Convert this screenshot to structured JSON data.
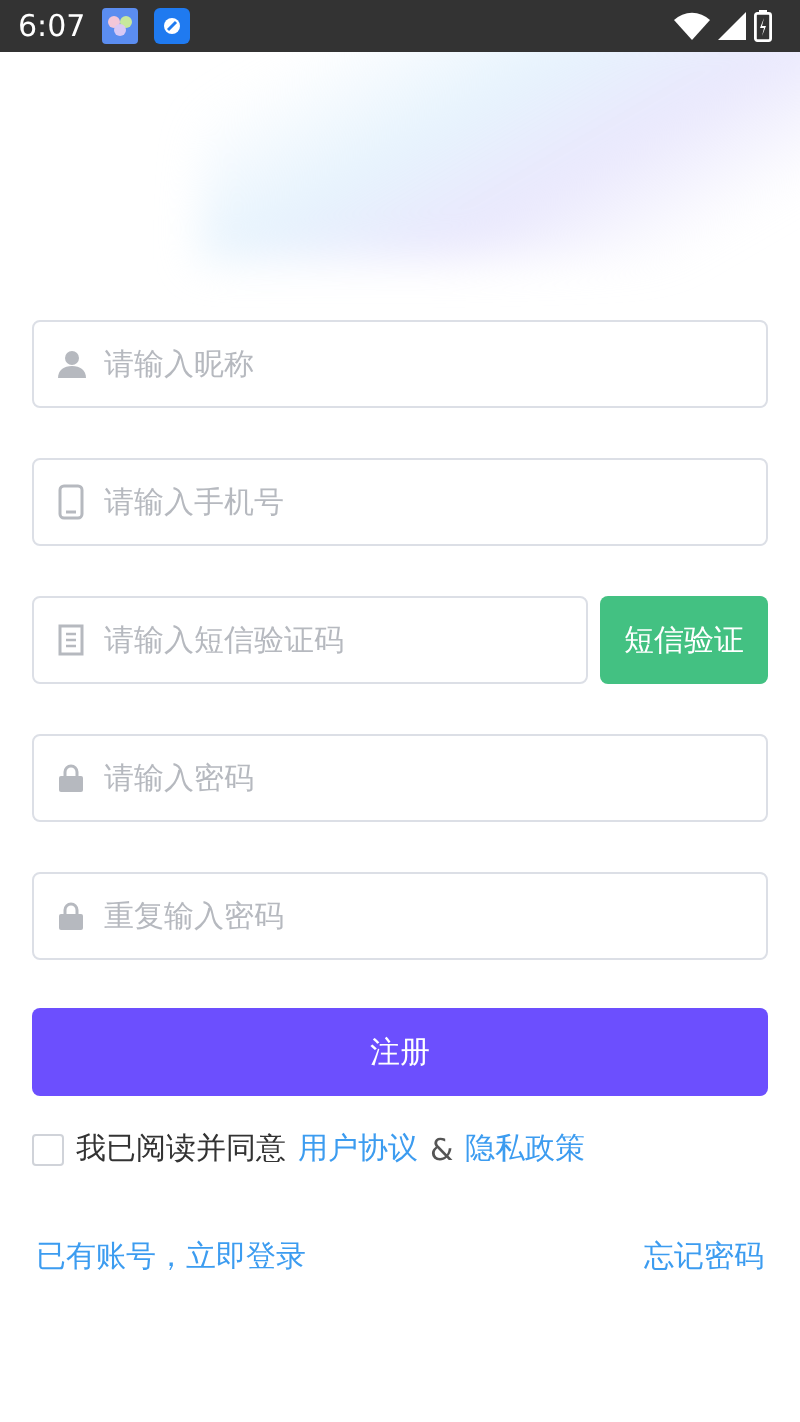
{
  "status_bar": {
    "time": "6:07"
  },
  "fields": [
    {
      "kind": "user",
      "placeholder": "请输入昵称"
    },
    {
      "kind": "phone",
      "placeholder": "请输入手机号"
    },
    {
      "kind": "code",
      "placeholder": "请输入短信验证码",
      "button": "短信验证"
    },
    {
      "kind": "lock",
      "placeholder": "请输入密码"
    },
    {
      "kind": "lock",
      "placeholder": "重复输入密码"
    }
  ],
  "submit_button": "注册",
  "agreement": {
    "checked": false,
    "text": "我已阅读并同意",
    "link_1": "用户协议",
    "separator": "&",
    "link_2": "隐私政策"
  },
  "footer": {
    "login_link": "已有账号，立即登录",
    "forgot_link": "忘记密码"
  }
}
